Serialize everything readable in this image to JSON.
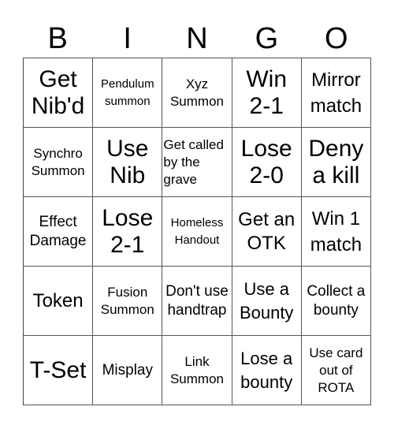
{
  "header": {
    "letters": [
      "B",
      "I",
      "N",
      "G",
      "O"
    ]
  },
  "cells": [
    [
      "Get Nib'd",
      "Pendulum summon",
      "Xyz Summon",
      "Win 2-1",
      "Mirror match"
    ],
    [
      "Synchro Summon",
      "Use Nib",
      "Get called by the grave",
      "Lose 2-0",
      "Deny a kill"
    ],
    [
      "Effect Damage",
      "Lose 2-1",
      "Homeless Handout",
      "Get an OTK",
      "Win 1 match"
    ],
    [
      "Token",
      "Fusion Summon",
      "Don't use handtrap",
      "Use a Bounty",
      "Collect a bounty"
    ],
    [
      "T-Set",
      "Misplay",
      "Link Summon",
      "Lose a bounty",
      "Use card out of ROTA"
    ]
  ]
}
